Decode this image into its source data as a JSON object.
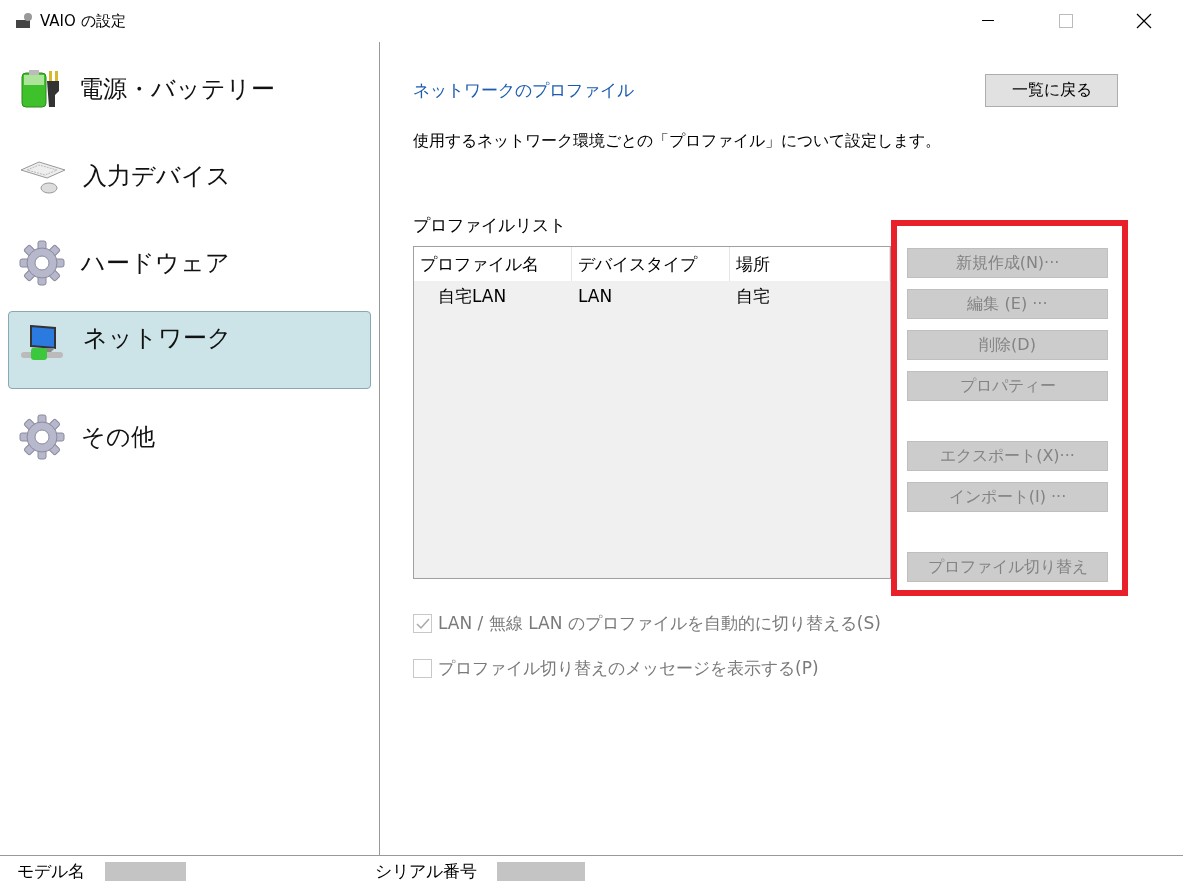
{
  "window": {
    "title": "VAIO の設定"
  },
  "sidebar": {
    "items": [
      {
        "label": "電源・バッテリー",
        "kind": "battery",
        "selected": false
      },
      {
        "label": "入力デバイス",
        "kind": "keyboard",
        "selected": false
      },
      {
        "label": "ハードウェア",
        "kind": "gear",
        "selected": false
      },
      {
        "label": "ネットワーク",
        "kind": "network",
        "selected": true
      },
      {
        "label": "その他",
        "kind": "gear",
        "selected": false
      }
    ]
  },
  "content": {
    "title": "ネットワークのプロファイル",
    "back_button": "一覧に戻る",
    "description": "使用するネットワーク環境ごとの「プロファイル」について設定します。",
    "list_label": "プロファイルリスト",
    "table": {
      "columns": [
        "プロファイル名",
        "デバイスタイプ",
        "場所"
      ],
      "rows": [
        {
          "cells": [
            "自宅LAN",
            "LAN",
            "自宅"
          ],
          "selected": false
        }
      ]
    },
    "button_panel": {
      "highlighted": true,
      "groups": [
        [
          {
            "label": "新規作成(N)···",
            "disabled": true
          },
          {
            "label": "編集 (E) ···",
            "disabled": true
          },
          {
            "label": "削除(D)",
            "disabled": true
          },
          {
            "label": "プロパティー",
            "disabled": true
          }
        ],
        [
          {
            "label": "エクスポート(X)···",
            "disabled": true
          },
          {
            "label": "インポート(I) ···",
            "disabled": true
          }
        ],
        [
          {
            "label": "プロファイル切り替え",
            "disabled": true
          }
        ]
      ]
    },
    "checkboxes": [
      {
        "label": "LAN / 無線 LAN のプロファイルを自動的に切り替える(S)",
        "checked": true,
        "disabled": true
      },
      {
        "label": "プロファイル切り替えのメッセージを表示する(P)",
        "checked": false,
        "disabled": true
      }
    ]
  },
  "status_bar": {
    "fields": [
      {
        "label": "モデル名",
        "redacted": true
      },
      {
        "label": "シリアル番号",
        "redacted": true
      }
    ]
  }
}
